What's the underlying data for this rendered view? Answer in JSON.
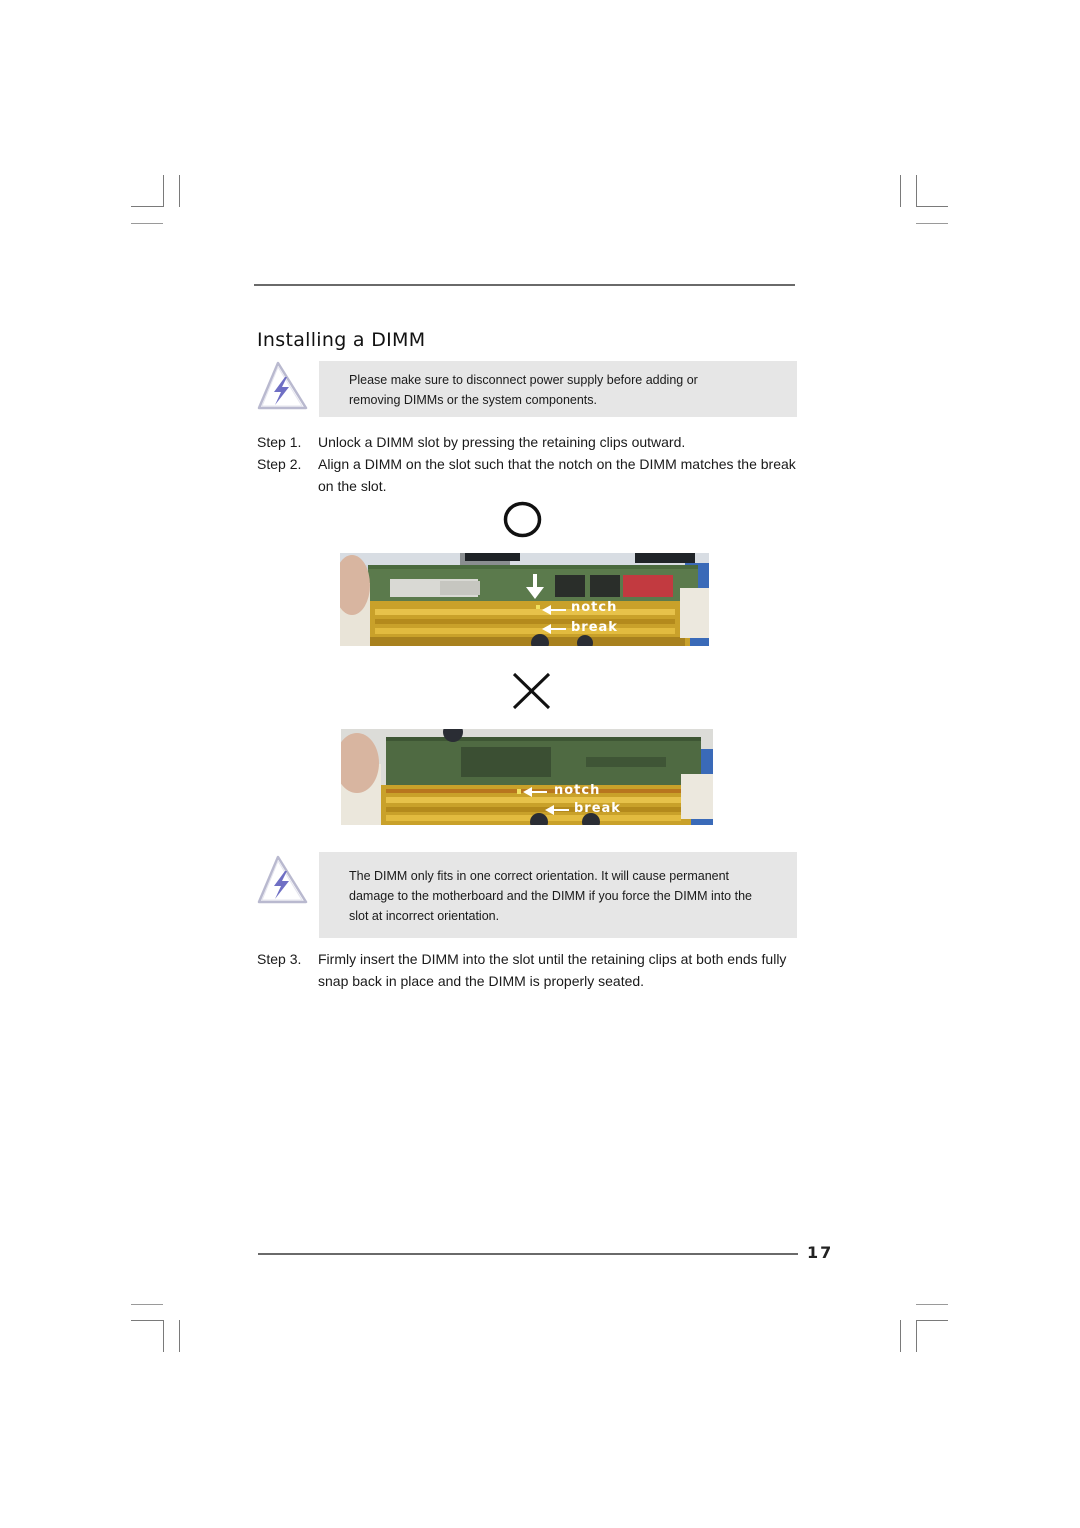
{
  "page": {
    "section_title": "Installing a DIMM",
    "page_number": "17"
  },
  "notes": [
    {
      "icon": "warning-lightning-icon",
      "lines": [
        "Please make sure to disconnect power supply before adding or",
        "removing DIMMs or the system components."
      ]
    },
    {
      "icon": "warning-lightning-icon",
      "lines": [
        "The DIMM only fits in one correct orientation. It will cause permanent",
        "damage to the motherboard and the DIMM if you force the DIMM into the",
        "slot at incorrect orientation."
      ]
    }
  ],
  "steps": [
    {
      "label": "Step 1.",
      "text": "Unlock a DIMM slot by pressing the retaining clips outward."
    },
    {
      "label": "Step 2.",
      "text": "Align a DIMM on the slot such that the notch on the DIMM matches the break on the slot."
    },
    {
      "label": "Step 3.",
      "text": "Firmly insert the DIMM into the slot until the retaining clips at both ends fully snap back in place and the DIMM is properly seated."
    }
  ],
  "figures": [
    {
      "verdict_symbol": "correct-circle-icon",
      "labels": {
        "notch": "notch",
        "break": "break"
      },
      "has_down_arrow": true
    },
    {
      "verdict_symbol": "incorrect-cross-icon",
      "labels": {
        "notch": "notch",
        "break": "break"
      },
      "has_down_arrow": false
    }
  ]
}
